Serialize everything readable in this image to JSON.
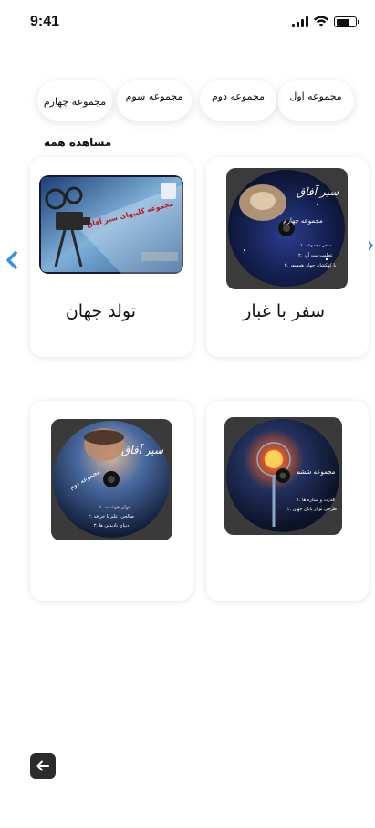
{
  "status_bar": {
    "time": "9:41",
    "battery_level": 0.7,
    "icons": [
      "signal-icon",
      "wifi-icon",
      "battery-icon"
    ]
  },
  "categories": [
    {
      "label": "مجموعه اول"
    },
    {
      "label": "مجموعه دوم"
    },
    {
      "label": "مجموعه سوم"
    },
    {
      "label": "مجموعه چهارم"
    }
  ],
  "section": {
    "see_all_label": "مشاهده همه"
  },
  "navigation": {
    "prev_icon": "chevron-left-icon",
    "next_icon": "chevron-right-icon",
    "back_icon": "arrow-left-icon"
  },
  "cards": [
    {
      "title": "سفر با غبار",
      "cover": {
        "header": "سیر آفاق",
        "subtitle": "مجموعه چهارم",
        "lines": [
          "۱. سفر مجموعه",
          "۲. عظمت بیت آور",
          "۳. با کهکشان جهان همسفر"
        ]
      }
    },
    {
      "title": "تولد جهان",
      "cover": {
        "header": "مجموعه کلیپهای سیر آفاق"
      }
    },
    {
      "title": "",
      "cover": {
        "subtitle": "مجموعه ششم",
        "lines": [
          "۱. قدرت و ستاره ها",
          "۲. طرحی نو از پایان جهان"
        ]
      }
    },
    {
      "title": "",
      "cover": {
        "header": "سیر آفاق",
        "subtitle": "مجموعه دوم",
        "lines": [
          "۱. جهان هوشمند",
          "۲. صالحی، علم یا خرافه",
          "۳. دنیای نادیدنی ها"
        ]
      }
    }
  ],
  "colors": {
    "accent": "#3a8ee6",
    "card_bg": "#ffffff",
    "back_button": "#2b2b2b"
  }
}
